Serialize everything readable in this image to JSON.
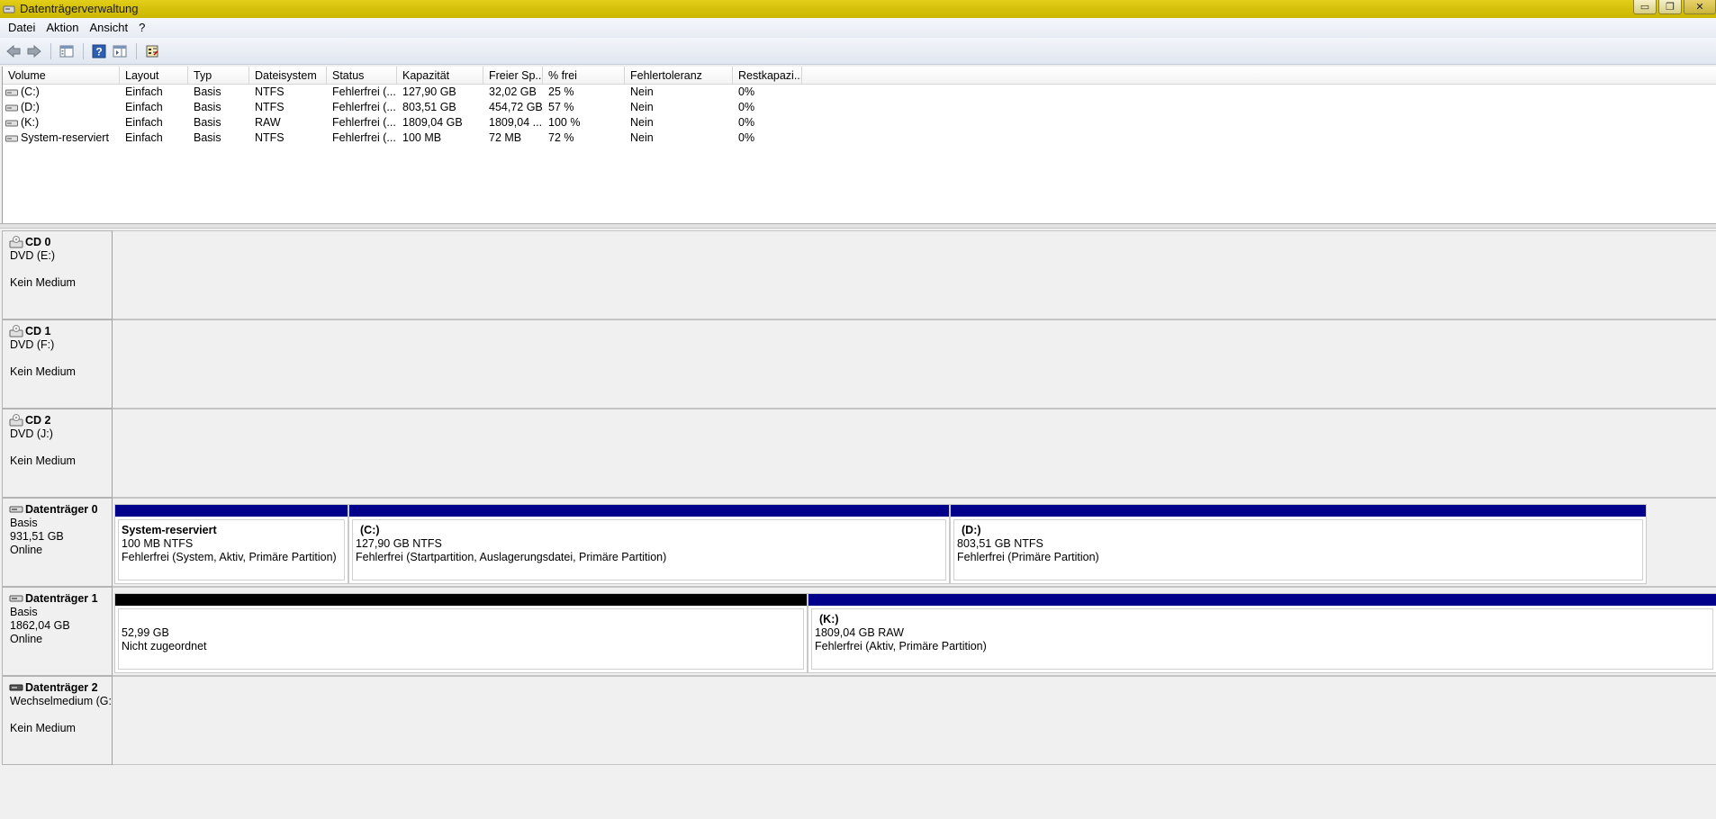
{
  "window": {
    "title": "Datenträgerverwaltung",
    "minimize": "▭",
    "restore": "❐",
    "close": "✕"
  },
  "menu": [
    "Datei",
    "Aktion",
    "Ansicht",
    "?"
  ],
  "toolbar": {
    "icons": [
      "back-arrow-icon",
      "forward-arrow-icon",
      "console-tree-icon",
      "help-icon",
      "action-pane-icon",
      "properties-icon"
    ]
  },
  "volume_list": {
    "columns": [
      "Volume",
      "Layout",
      "Typ",
      "Dateisystem",
      "Status",
      "Kapazität",
      "Freier Sp...",
      "% frei",
      "Fehlertoleranz",
      "Restkapazi..."
    ],
    "rows": [
      [
        "(C:)",
        "Einfach",
        "Basis",
        "NTFS",
        "Fehlerfrei (...",
        "127,90 GB",
        "32,02 GB",
        "25 %",
        "Nein",
        "0%"
      ],
      [
        "(D:)",
        "Einfach",
        "Basis",
        "NTFS",
        "Fehlerfrei (...",
        "803,51 GB",
        "454,72 GB",
        "57 %",
        "Nein",
        "0%"
      ],
      [
        "(K:)",
        "Einfach",
        "Basis",
        "RAW",
        "Fehlerfrei (...",
        "1809,04 GB",
        "1809,04 ...",
        "100 %",
        "Nein",
        "0%"
      ],
      [
        "System-reserviert",
        "Einfach",
        "Basis",
        "NTFS",
        "Fehlerfrei (...",
        "100 MB",
        "72 MB",
        "72 %",
        "Nein",
        "0%"
      ]
    ]
  },
  "disks": [
    {
      "name": "CD 0",
      "lines": [
        "DVD (E:)"
      ],
      "status": "Kein Medium"
    },
    {
      "name": "CD 1",
      "lines": [
        "DVD (F:)"
      ],
      "status": "Kein Medium"
    },
    {
      "name": "CD 2",
      "lines": [
        "DVD (J:)"
      ],
      "status": "Kein Medium"
    },
    {
      "name": "Datenträger 0",
      "lines": [
        "Basis",
        "931,51 GB",
        "Online"
      ]
    },
    {
      "name": "Datenträger 1",
      "lines": [
        "Basis",
        "1862,04 GB",
        "Online"
      ]
    },
    {
      "name": "Datenträger 2",
      "lines": [
        "Wechselmedium (G:"
      ],
      "status": "Kein Medium"
    }
  ],
  "partitions": {
    "disk0": [
      {
        "title": "System-reserviert",
        "size": "100 MB NTFS",
        "status": "Fehlerfrei (System, Aktiv, Primäre Partition)"
      },
      {
        "title": "(C:)",
        "size": "127,90 GB NTFS",
        "status": "Fehlerfrei (Startpartition, Auslagerungsdatei, Primäre Partition)"
      },
      {
        "title": "(D:)",
        "size": "803,51 GB NTFS",
        "status": "Fehlerfrei (Primäre Partition)"
      }
    ],
    "disk1": [
      {
        "title": "",
        "size": "52,99 GB",
        "status": "Nicht zugeordnet"
      },
      {
        "title": "(K:)",
        "size": "1809,04 GB RAW",
        "status": "Fehlerfrei (Aktiv, Primäre Partition)"
      }
    ]
  },
  "colors": {
    "titlebar": "#d6c10c",
    "primary_partition": "#00008b",
    "unallocated": "#000000"
  }
}
